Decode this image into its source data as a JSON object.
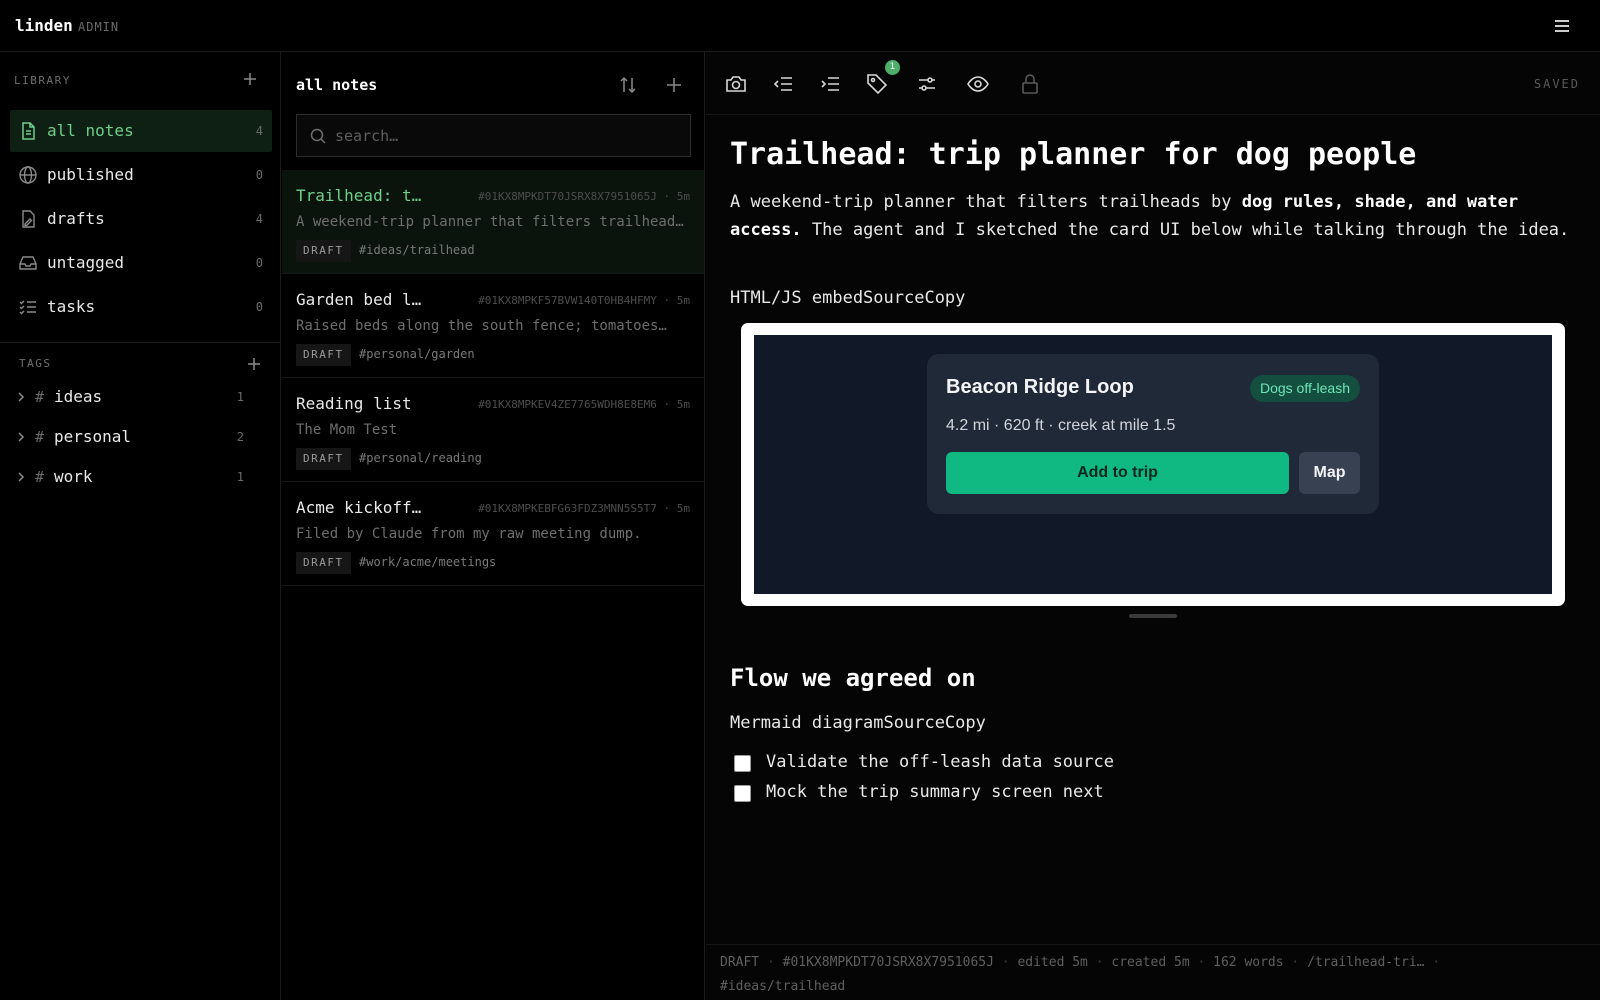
{
  "app": {
    "name": "linden",
    "role": "ADMIN"
  },
  "icons": {
    "menu": "hamburger-icon",
    "sort": "sort-arrows-icon",
    "add": "plus-icon",
    "search": "search-icon"
  },
  "colors": {
    "accent": "#6fcf8b",
    "background": "#000000",
    "card_primary": "#10b981"
  },
  "sidebar": {
    "library_label": "LIBRARY",
    "items": [
      {
        "label": "all notes",
        "count": "4",
        "icon": "document-icon",
        "active": true
      },
      {
        "label": "published",
        "count": "0",
        "icon": "globe-icon"
      },
      {
        "label": "drafts",
        "count": "4",
        "icon": "draft-icon"
      },
      {
        "label": "untagged",
        "count": "0",
        "icon": "inbox-icon"
      },
      {
        "label": "tasks",
        "count": "0",
        "icon": "checklist-icon"
      }
    ],
    "tags_label": "TAGS",
    "tags": [
      {
        "label": "ideas",
        "count": "1"
      },
      {
        "label": "personal",
        "count": "2"
      },
      {
        "label": "work",
        "count": "1"
      }
    ]
  },
  "notes": {
    "title": "all notes",
    "search_placeholder": "search…",
    "items": [
      {
        "title": "Trailhead: t…",
        "meta": "#01KX8MPKDT70JSRX8X7951065J · 5m",
        "excerpt": "A weekend-trip planner that filters trailhead…",
        "status": "DRAFT",
        "tag": "#ideas/trailhead",
        "active": true
      },
      {
        "title": "Garden bed l…",
        "meta": "#01KX8MPKF57BVW140T0HB4HFMY · 5m",
        "excerpt": "Raised beds along the south fence; tomatoes…",
        "status": "DRAFT",
        "tag": "#personal/garden"
      },
      {
        "title": "Reading list",
        "meta": "#01KX8MPKEV4ZE7765WDH8E8EM6 · 5m",
        "excerpt": "The Mom Test",
        "status": "DRAFT",
        "tag": "#personal/reading"
      },
      {
        "title": "Acme kickoff…",
        "meta": "#01KX8MPKEBFG63FDZ3MNN5S5T7 · 5m",
        "excerpt": "Filed by Claude from my raw meeting dump.",
        "status": "DRAFT",
        "tag": "#work/acme/meetings"
      }
    ]
  },
  "editor": {
    "toolbar_icons": [
      "camera-icon",
      "outdent-icon",
      "indent-icon",
      "tag-icon",
      "sliders-icon",
      "eye-icon",
      "lock-icon"
    ],
    "tag_badge": "1",
    "save_status": "SAVED",
    "title": "Trailhead: trip planner for dog people",
    "paragraph_start": "A weekend-trip planner that filters trailheads by ",
    "paragraph_bold": "dog rules, shade, and water access.",
    "paragraph_end": " The agent and I sketched the card UI below while talking through the idea.",
    "embed_label": "HTML/JS embedSourceCopy",
    "embed": {
      "card_title": "Beacon Ridge Loop",
      "pill": "Dogs off-leash",
      "meta": "4.2 mi · 620 ft · creek at mile 1.5",
      "primary_button": "Add to trip",
      "secondary_button": "Map"
    },
    "heading2": "Flow we agreed on",
    "mermaid_label": "Mermaid diagramSourceCopy",
    "tasks": [
      {
        "text": "Validate the off-leash data source",
        "checked": false
      },
      {
        "text": "Mock the trip summary screen next",
        "checked": false
      }
    ],
    "footer": {
      "status": "DRAFT",
      "id": "#01KX8MPKDT70JSRX8X7951065J",
      "edited": "edited 5m",
      "created": "created 5m",
      "words": "162 words",
      "slug": "/trailhead-tri…",
      "tag": "#ideas/trailhead"
    }
  }
}
